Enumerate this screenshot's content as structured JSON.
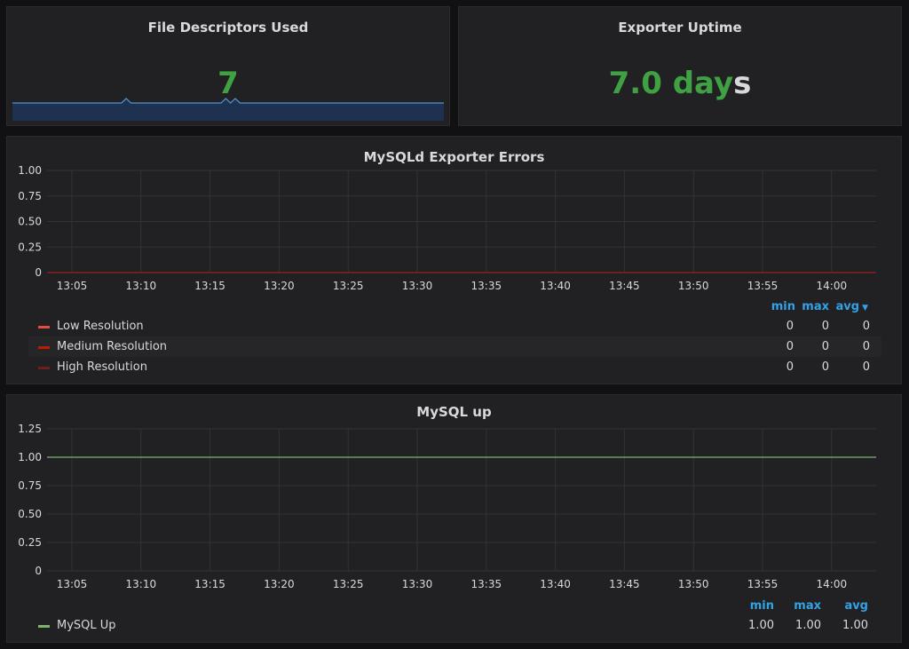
{
  "panels": {
    "fd": {
      "title": "File Descriptors Used",
      "value": "7",
      "sparkline": [
        0,
        0,
        0,
        0,
        0,
        0,
        0,
        0,
        0,
        0,
        0,
        0,
        0,
        0,
        0,
        0,
        0,
        0,
        0,
        0,
        0,
        0,
        0,
        0,
        1,
        0,
        0,
        0,
        0,
        0,
        0,
        0,
        0,
        0,
        0,
        0,
        0,
        0,
        0,
        0,
        0,
        0,
        0,
        0,
        0,
        1,
        0,
        1,
        0,
        0,
        0,
        0,
        0,
        0,
        0,
        0,
        0,
        0,
        0,
        0,
        0,
        0,
        0,
        0,
        0,
        0,
        0,
        0,
        0,
        0,
        0,
        0,
        0,
        0,
        0,
        0,
        0,
        0,
        0,
        0,
        0,
        0,
        0,
        0,
        0,
        0,
        0,
        0,
        0,
        0,
        0,
        0
      ]
    },
    "uptime": {
      "title": "Exporter Uptime",
      "value_num": "7.0 day",
      "value_unit": "s"
    },
    "errors": {
      "title": "MySQLd Exporter Errors",
      "legend_headers": {
        "min": "min",
        "max": "max",
        "avg": "avg"
      },
      "legend": [
        {
          "name": "Low Resolution",
          "color": "#e24d42",
          "min": "0",
          "max": "0",
          "avg": "0"
        },
        {
          "name": "Medium Resolution",
          "color": "#bf1b00",
          "min": "0",
          "max": "0",
          "avg": "0"
        },
        {
          "name": "High Resolution",
          "color": "#6d1f1f",
          "min": "0",
          "max": "0",
          "avg": "0"
        }
      ]
    },
    "up": {
      "title": "MySQL up",
      "legend_headers": {
        "min": "min",
        "max": "max",
        "avg": "avg"
      },
      "legend": [
        {
          "name": "MySQL Up",
          "color": "#7eb26d",
          "min": "1.00",
          "max": "1.00",
          "avg": "1.00"
        }
      ]
    }
  },
  "chart_data": [
    {
      "type": "line",
      "title": "MySQLd Exporter Errors",
      "x": [
        "13:05",
        "13:10",
        "13:15",
        "13:20",
        "13:25",
        "13:30",
        "13:35",
        "13:40",
        "13:45",
        "13:50",
        "13:55",
        "14:00"
      ],
      "yticks": [
        "1.00",
        "0.75",
        "0.50",
        "0.25",
        "0"
      ],
      "ylim": [
        0,
        1
      ],
      "series": [
        {
          "name": "Low Resolution",
          "color": "#e24d42",
          "values": [
            0,
            0,
            0,
            0,
            0,
            0,
            0,
            0,
            0,
            0,
            0,
            0
          ]
        },
        {
          "name": "Medium Resolution",
          "color": "#bf1b00",
          "values": [
            0,
            0,
            0,
            0,
            0,
            0,
            0,
            0,
            0,
            0,
            0,
            0
          ]
        },
        {
          "name": "High Resolution",
          "color": "#6d1f1f",
          "values": [
            0,
            0,
            0,
            0,
            0,
            0,
            0,
            0,
            0,
            0,
            0,
            0
          ]
        }
      ]
    },
    {
      "type": "line",
      "title": "MySQL up",
      "x": [
        "13:05",
        "13:10",
        "13:15",
        "13:20",
        "13:25",
        "13:30",
        "13:35",
        "13:40",
        "13:45",
        "13:50",
        "13:55",
        "14:00"
      ],
      "yticks": [
        "1.25",
        "1.00",
        "0.75",
        "0.50",
        "0.25",
        "0"
      ],
      "ylim": [
        0,
        1.25
      ],
      "series": [
        {
          "name": "MySQL Up",
          "color": "#7eb26d",
          "values": [
            1,
            1,
            1,
            1,
            1,
            1,
            1,
            1,
            1,
            1,
            1,
            1
          ]
        }
      ]
    }
  ]
}
